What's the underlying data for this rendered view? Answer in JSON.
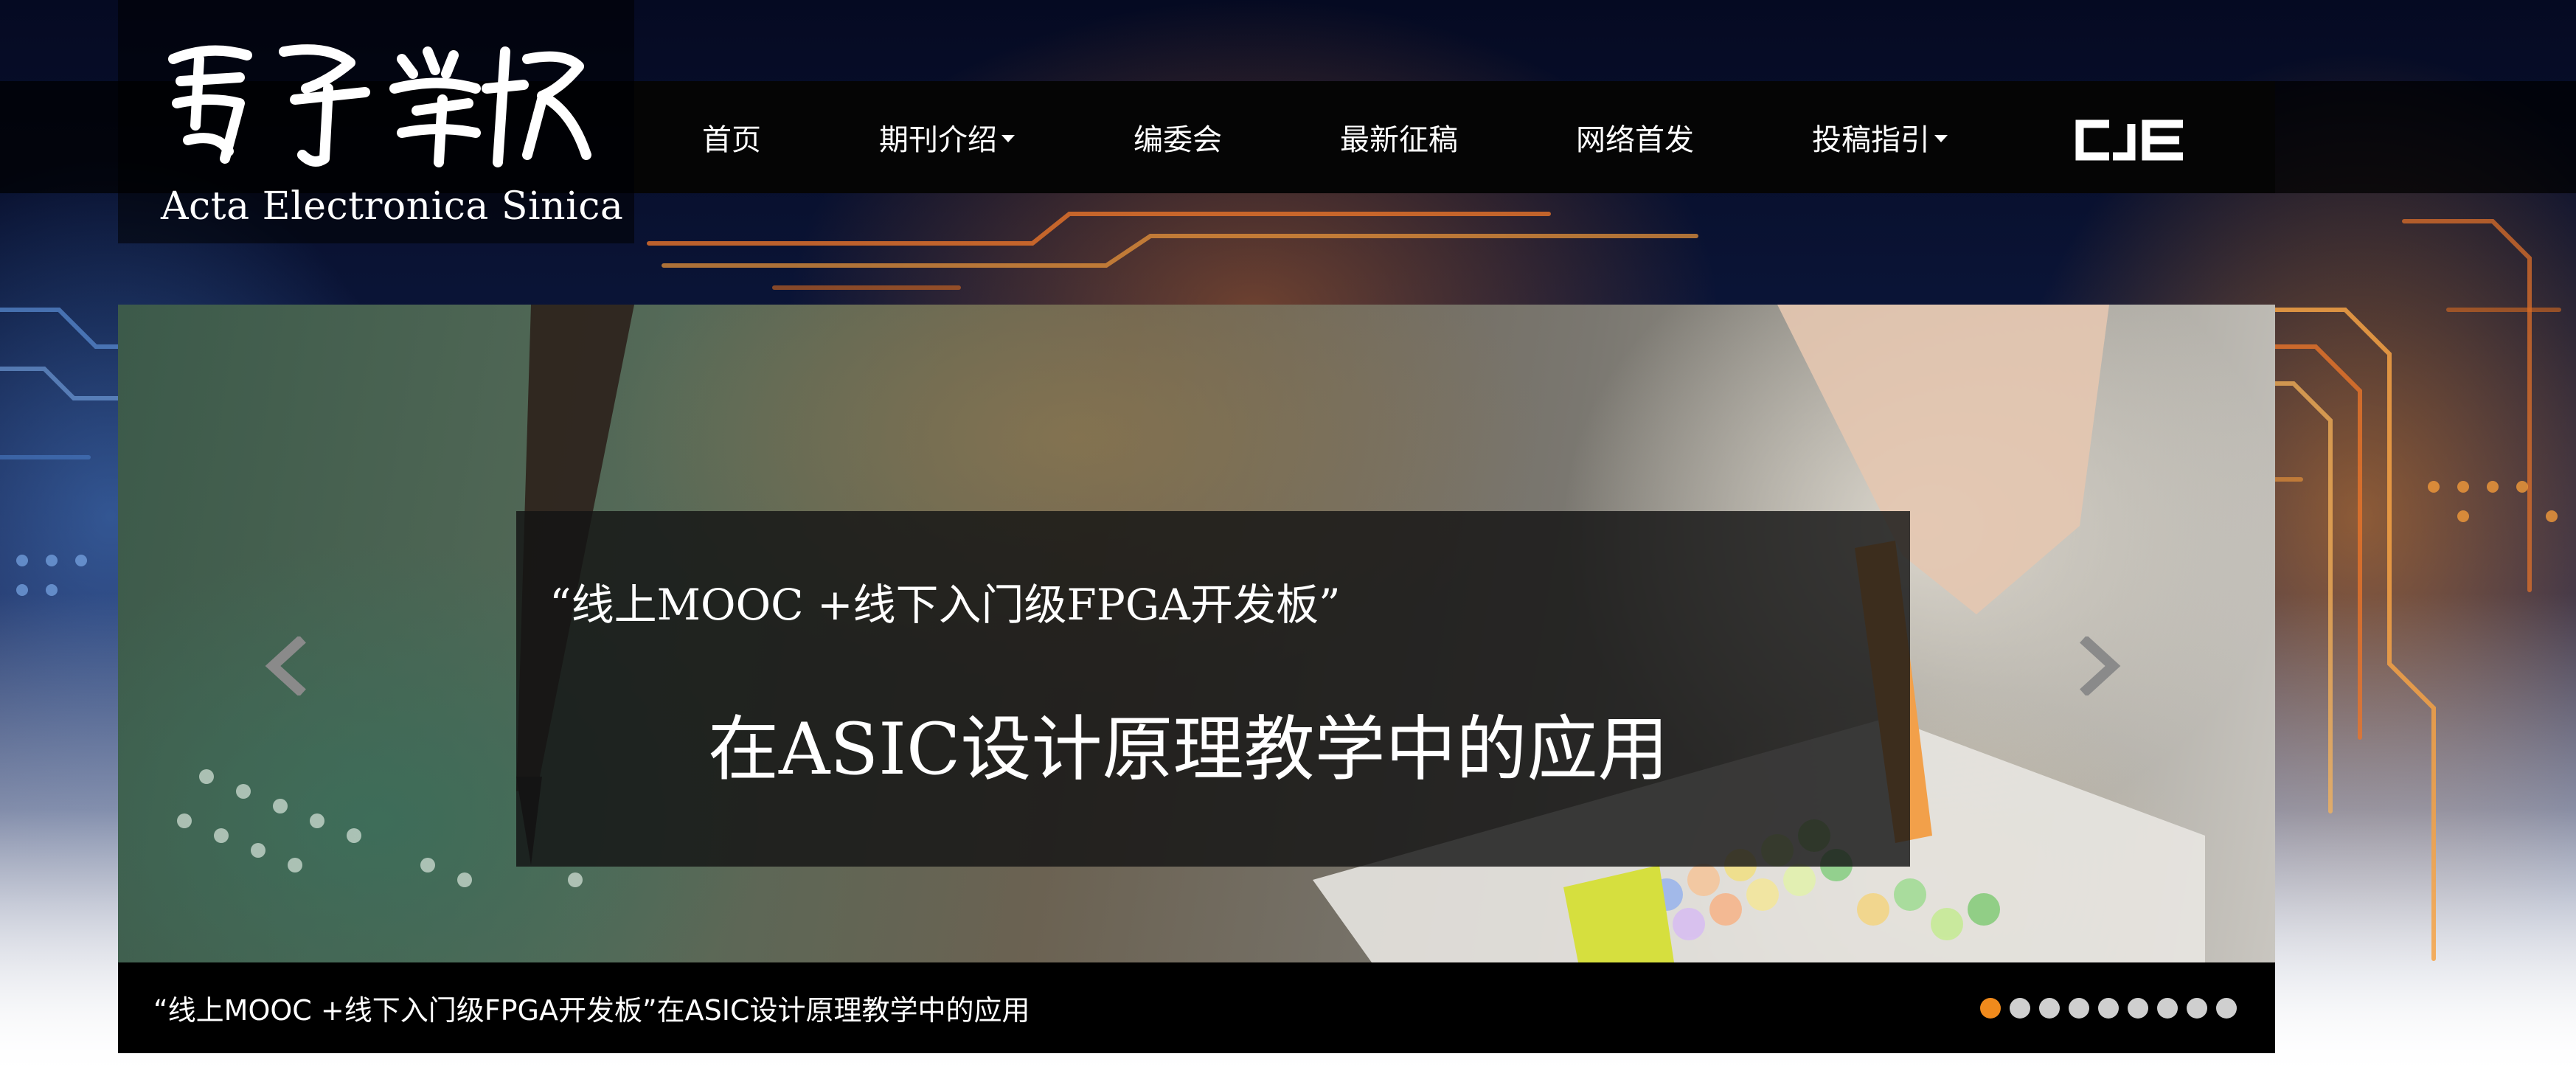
{
  "logo": {
    "chinese_name": "電子学報",
    "english_name": "Acta Electronica Sinica",
    "icon": "calligraphy-logo"
  },
  "nav": {
    "items": [
      {
        "label": "首页",
        "has_dropdown": false
      },
      {
        "label": "期刊介绍",
        "has_dropdown": true
      },
      {
        "label": "编委会",
        "has_dropdown": false
      },
      {
        "label": "最新征稿",
        "has_dropdown": false
      },
      {
        "label": "网络首发",
        "has_dropdown": false
      },
      {
        "label": "投稿指引",
        "has_dropdown": true
      }
    ],
    "partner_logo": "CJE"
  },
  "carousel": {
    "slide": {
      "line1": "“线上MOOC +线下入门级FPGA开发板”",
      "line2": "在ASIC设计原理教学中的应用",
      "caption": "“线上MOOC +线下入门级FPGA开发板”在ASIC设计原理教学中的应用"
    },
    "prev_icon": "chevron-left-icon",
    "next_icon": "chevron-right-icon",
    "dot_count": 9,
    "active_dot": 1
  },
  "colors": {
    "accent": "#f08a1c",
    "nav_bg": "#050505",
    "dot_inactive": "#cfcfcf"
  }
}
